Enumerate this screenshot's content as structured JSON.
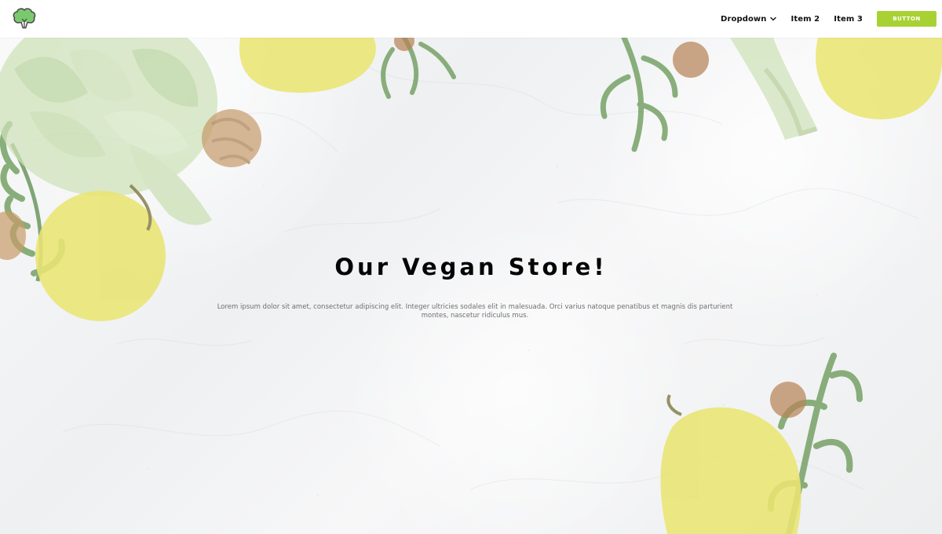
{
  "navbar": {
    "logo": {
      "icon": "broccoli-icon",
      "colors": {
        "fill": "#7bc96f",
        "stroke": "#4a4a4a"
      }
    },
    "items": [
      {
        "label": "Dropdown",
        "icon": "chevron-down-icon"
      },
      {
        "label": "Item 2"
      },
      {
        "label": "Item 3"
      }
    ],
    "button": {
      "label": "BUTTON",
      "color": "#a8d233"
    }
  },
  "hero": {
    "title": "Our Vegan Store!",
    "description": "Lorem ipsum dolor sit amet, consectetur adipiscing elit. Integer ultricies sodales elit in malesuada. Orci varius natoque penatibus et magnis dis parturient montes, nascetur ridiculus mus.",
    "background": {
      "colors": {
        "surface": "#f1f2f3",
        "artichoke": "#cfe2b9",
        "pear": "#e9e572",
        "leaf": "#6a9a58",
        "nut": "#c79b6a"
      },
      "icons": [
        "artichoke-icon",
        "pear-icon",
        "walnut-icon",
        "hazelnut-icon",
        "carrot-leaf-icon"
      ]
    }
  }
}
